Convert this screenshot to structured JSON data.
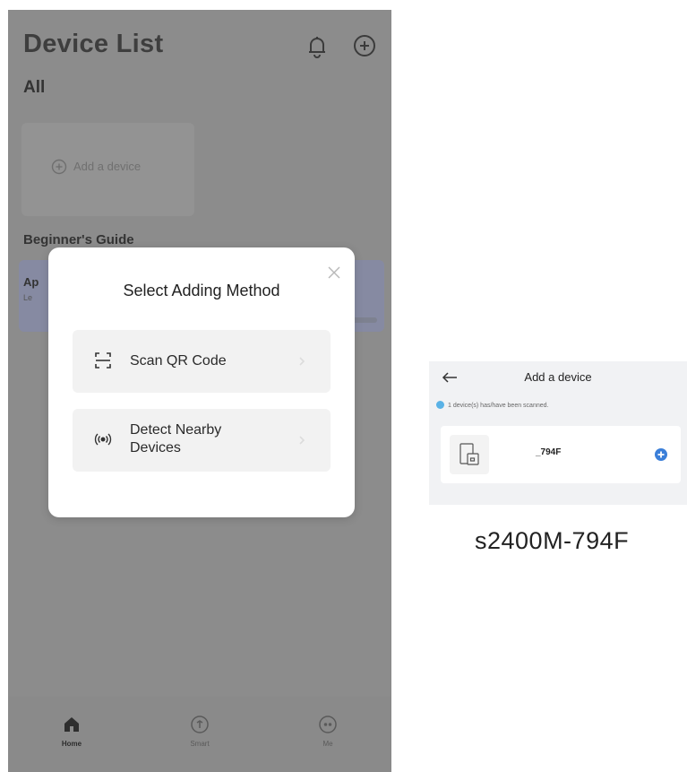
{
  "phone": {
    "title": "Device List",
    "section_all": "All",
    "add_device_label": "Add a device",
    "beginners_guide": "Beginner's Guide",
    "guide_card": {
      "title": "Ap",
      "subtitle": "Le"
    },
    "icons": {
      "bell": "bell-icon",
      "add": "plus-circle-icon"
    },
    "tabs": [
      {
        "label": "Home",
        "icon": "home-icon",
        "active": true
      },
      {
        "label": "Smart",
        "icon": "smart-icon",
        "active": false
      },
      {
        "label": "Me",
        "icon": "me-icon",
        "active": false
      }
    ]
  },
  "modal": {
    "title": "Select Adding Method",
    "methods": [
      {
        "label": "Scan QR Code",
        "icon": "scan-qr-icon"
      },
      {
        "label": "Detect Nearby Devices",
        "icon": "nearby-broadcast-icon"
      }
    ]
  },
  "add_device_screen": {
    "title": "Add a device",
    "status": "1 device(s) has/have been scanned.",
    "device_name": "_794F"
  },
  "caption": "s2400M-794F",
  "colors": {
    "overlay": "#8c8c8c",
    "accent_blue": "#3b7fd9",
    "modal_bg": "#ffffff"
  }
}
